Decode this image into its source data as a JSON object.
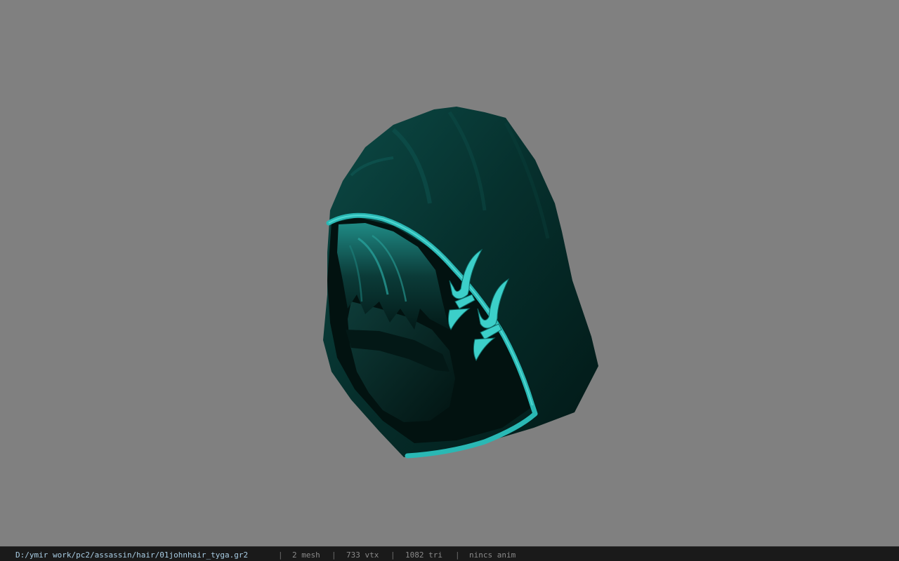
{
  "viewport": {
    "background_color": "#808080",
    "model": {
      "name": "hooded-head-model",
      "base_color": "#062a28",
      "trim_color": "#2ab8b4",
      "accent_color": "#40d8d2"
    }
  },
  "status": {
    "file_path": "D:/ymir work/pc2/assassin/hair/01johnhair_tyga.gr2",
    "separator": "|",
    "mesh": "2 mesh",
    "vertices": "733 vtx",
    "triangles": "1082 tri",
    "anim": "nincs anim"
  }
}
